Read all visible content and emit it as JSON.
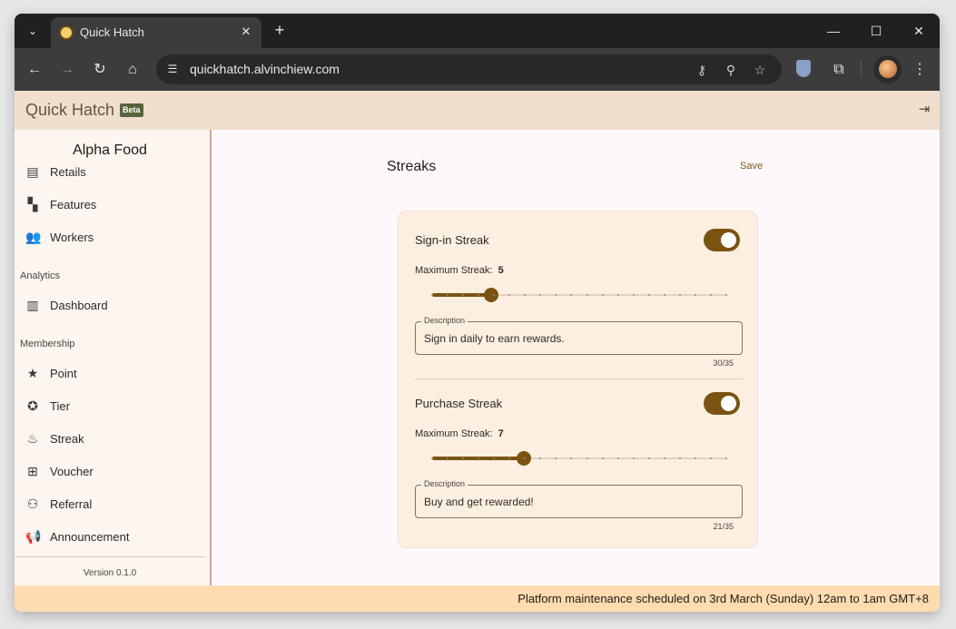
{
  "browser": {
    "tab_title": "Quick Hatch",
    "url": "quickhatch.alvinchiew.com"
  },
  "app": {
    "title": "Quick Hatch",
    "badge": "Beta"
  },
  "sidebar": {
    "brand": "Alpha Food",
    "items_top": [
      {
        "label": "Retails",
        "icon": "store-icon"
      },
      {
        "label": "Features",
        "icon": "dashboard-widgets-icon"
      },
      {
        "label": "Workers",
        "icon": "people-icon"
      }
    ],
    "sections": [
      {
        "label": "Analytics",
        "items": [
          {
            "label": "Dashboard",
            "icon": "chart-icon"
          }
        ]
      },
      {
        "label": "Membership",
        "items": [
          {
            "label": "Point",
            "icon": "star-icon"
          },
          {
            "label": "Tier",
            "icon": "badge-icon"
          },
          {
            "label": "Streak",
            "icon": "fire-icon"
          },
          {
            "label": "Voucher",
            "icon": "gift-icon"
          },
          {
            "label": "Referral",
            "icon": "person-add-icon"
          },
          {
            "label": "Announcement",
            "icon": "megaphone-icon"
          }
        ]
      }
    ],
    "version": "Version 0.1.0"
  },
  "main": {
    "title": "Streaks",
    "save_label": "Save",
    "streaks": [
      {
        "name": "Sign-in Streak",
        "enabled": true,
        "max_label": "Maximum Streak:",
        "max_value": "5",
        "slider_fraction": 0.2,
        "description_label": "Description",
        "description": "Sign in daily to earn rewards.",
        "counter": "30/35"
      },
      {
        "name": "Purchase Streak",
        "enabled": true,
        "max_label": "Maximum Streak:",
        "max_value": "7",
        "slider_fraction": 0.3125,
        "description_label": "Description",
        "description": "Buy and get rewarded!",
        "counter": "21/35"
      }
    ]
  },
  "banner": {
    "text": "Platform maintenance scheduled on 3rd March (Sunday) 12am to 1am GMT+8"
  },
  "colors": {
    "accent": "#7a5312",
    "header_bg": "#efdfcc",
    "banner_bg": "#ffdcb0",
    "card_bg": "#fcefe1"
  }
}
